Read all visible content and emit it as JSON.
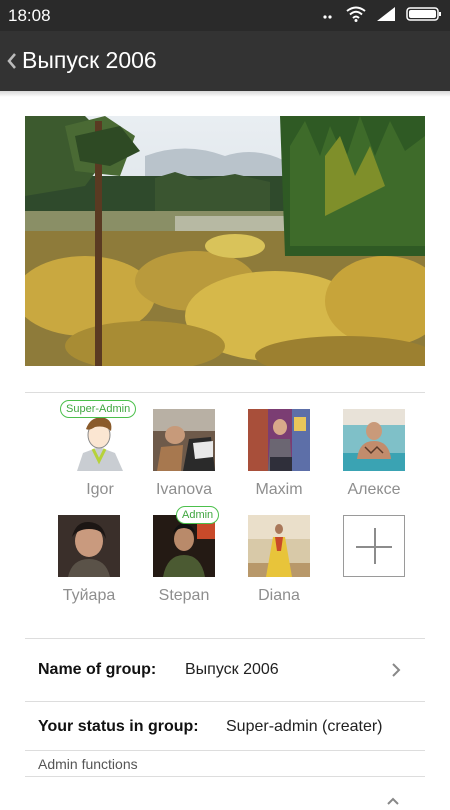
{
  "status_bar": {
    "time": "18:08",
    "icons": [
      "signal-dots-icon",
      "wifi-icon",
      "cellular-signal-icon",
      "battery-icon"
    ]
  },
  "app_bar": {
    "title": "Выпуск 2006",
    "back_icon": "back-chevron-icon"
  },
  "group_photo": {
    "description_icon": "group-cover-photo"
  },
  "members": [
    {
      "name": "Igor",
      "role": "Super-Admin"
    },
    {
      "name": "Ivanova",
      "role": ""
    },
    {
      "name": "Maxim",
      "role": ""
    },
    {
      "name": "Алексе",
      "role": ""
    },
    {
      "name": "Туйара",
      "role": ""
    },
    {
      "name": "Stepan",
      "role": "Admin"
    },
    {
      "name": "Diana",
      "role": ""
    }
  ],
  "add_member_icon": "plus-icon",
  "details": {
    "group_name_label": "Name of group:",
    "group_name_value": "Выпуск 2006",
    "status_label": "Your status in group:",
    "status_value": "Super-admin (creater)",
    "admin_section_label": "Admin functions"
  },
  "colors": {
    "status_bar_bg": "#2a2a2a",
    "app_bar_bg": "#333333",
    "badge_green": "#4cc04c",
    "muted_text": "#8e8e8e"
  }
}
